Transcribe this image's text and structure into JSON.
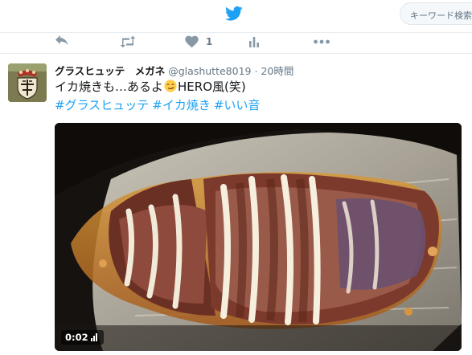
{
  "header": {
    "logo_icon": "twitter-bird-icon",
    "search_placeholder": "キーワード検索",
    "brand_color": "#1da1f2"
  },
  "previous_tweet_actions": {
    "reply_icon": "reply-icon",
    "retweet_icon": "retweet-icon",
    "like_icon": "heart-icon",
    "like_count": "1",
    "analytics_icon": "analytics-icon",
    "more_icon": "more-icon"
  },
  "tweet": {
    "author_name": "グラスヒュッテ　メガネ",
    "handle": "@glashutte8019",
    "separator": "·",
    "time": "20時間",
    "text_before_emoji": "イカ焼きも…あるよ",
    "emoji_icon": "smirking-face-emoji",
    "text_after_emoji": "HERO風(笑)",
    "hashtags": [
      "#グラスヒュッテ",
      "#イカ焼き",
      "#いい音"
    ],
    "media": {
      "type": "video",
      "timestamp": "0:02",
      "volume_icon": "volume-icon"
    }
  }
}
